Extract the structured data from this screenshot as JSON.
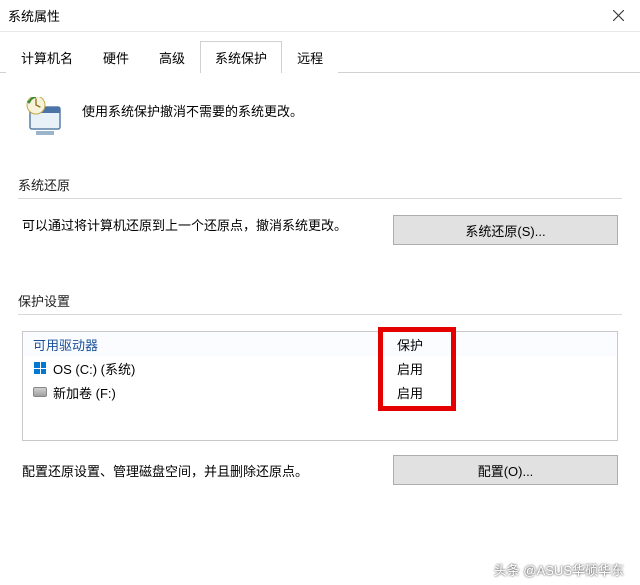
{
  "titlebar": {
    "title": "系统属性"
  },
  "tabs": [
    "计算机名",
    "硬件",
    "高级",
    "系统保护",
    "远程"
  ],
  "activeTab": 3,
  "intro": {
    "text": "使用系统保护撤消不需要的系统更改。"
  },
  "restore": {
    "group_label": "系统还原",
    "desc": "可以通过将计算机还原到上一个还原点，撤消系统更改。",
    "button": "系统还原(S)..."
  },
  "protect": {
    "group_label": "保护设置",
    "columns": {
      "drive": "可用驱动器",
      "status": "保护"
    },
    "rows": [
      {
        "icon": "windows-drive-icon",
        "label": "OS (C:) (系统)",
        "status": "启用"
      },
      {
        "icon": "disk-drive-icon",
        "label": "新加卷 (F:)",
        "status": "启用"
      }
    ]
  },
  "config": {
    "desc": "配置还原设置、管理磁盘空间，并且删除还原点。",
    "button": "配置(O)..."
  },
  "watermark": "头条 @ASUS华硕华东"
}
